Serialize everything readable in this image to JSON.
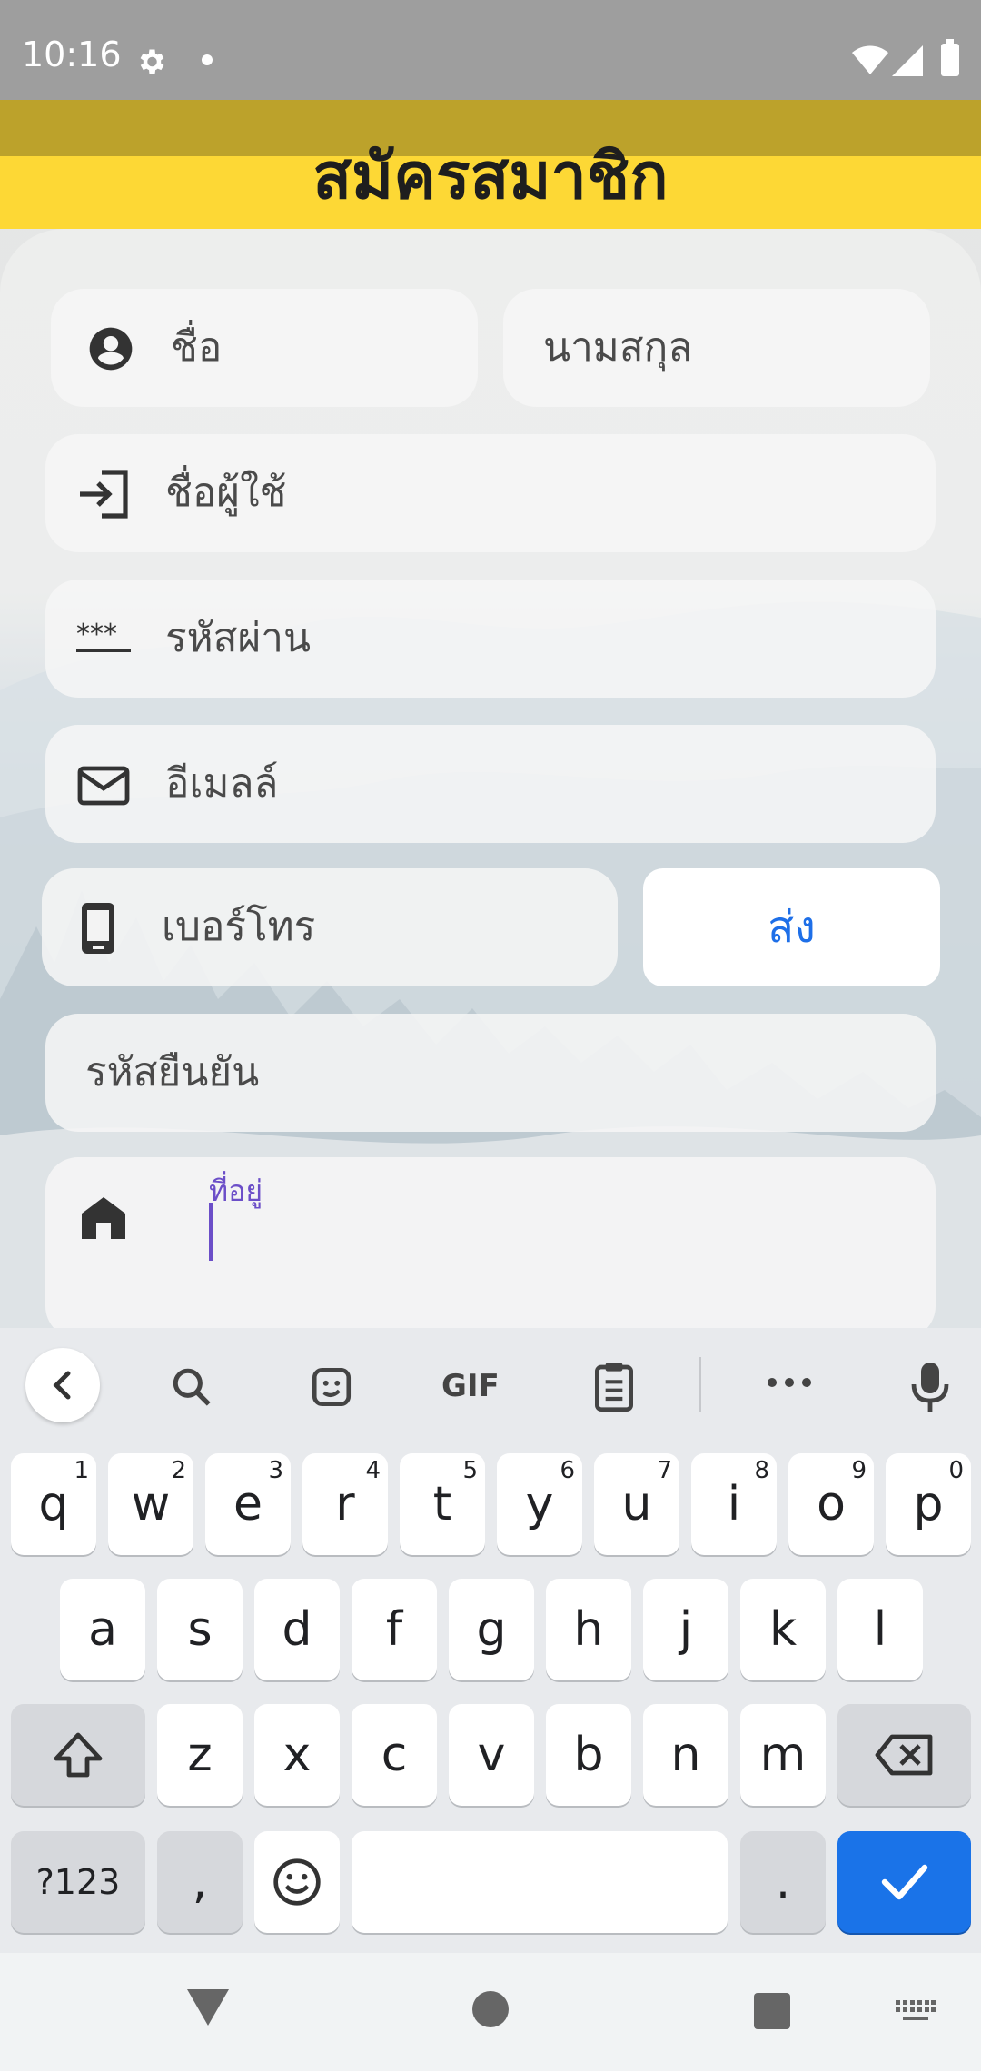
{
  "status_bar": {
    "time": "10:16"
  },
  "header": {
    "title": "สมัครสมาชิก"
  },
  "form": {
    "first_name_label": "ชื่อ",
    "last_name_label": "นามสกุล",
    "username_label": "ชื่อผู้ใช้",
    "password_label": "รหัสผ่าน",
    "email_label": "อีเมลล์",
    "phone_label": "เบอร์โทร",
    "send_button": "ส่ง",
    "verify_code_label": "รหัสยืนยัน",
    "address_label": "ที่อยู่"
  },
  "keyboard": {
    "row1": [
      {
        "k": "q",
        "n": "1"
      },
      {
        "k": "w",
        "n": "2"
      },
      {
        "k": "e",
        "n": "3"
      },
      {
        "k": "r",
        "n": "4"
      },
      {
        "k": "t",
        "n": "5"
      },
      {
        "k": "y",
        "n": "6"
      },
      {
        "k": "u",
        "n": "7"
      },
      {
        "k": "i",
        "n": "8"
      },
      {
        "k": "o",
        "n": "9"
      },
      {
        "k": "p",
        "n": "0"
      }
    ],
    "row2": [
      "a",
      "s",
      "d",
      "f",
      "g",
      "h",
      "j",
      "k",
      "l"
    ],
    "row3": [
      "z",
      "x",
      "c",
      "v",
      "b",
      "n",
      "m"
    ],
    "symbols_key": "?123",
    "comma_key": ",",
    "period_key": ".",
    "gif_label": "GIF"
  },
  "colors": {
    "header_yellow": "#fdd835",
    "send_text": "#1e6fe8",
    "cursor": "#6b4ec8",
    "enter_key": "#1a73e8"
  }
}
